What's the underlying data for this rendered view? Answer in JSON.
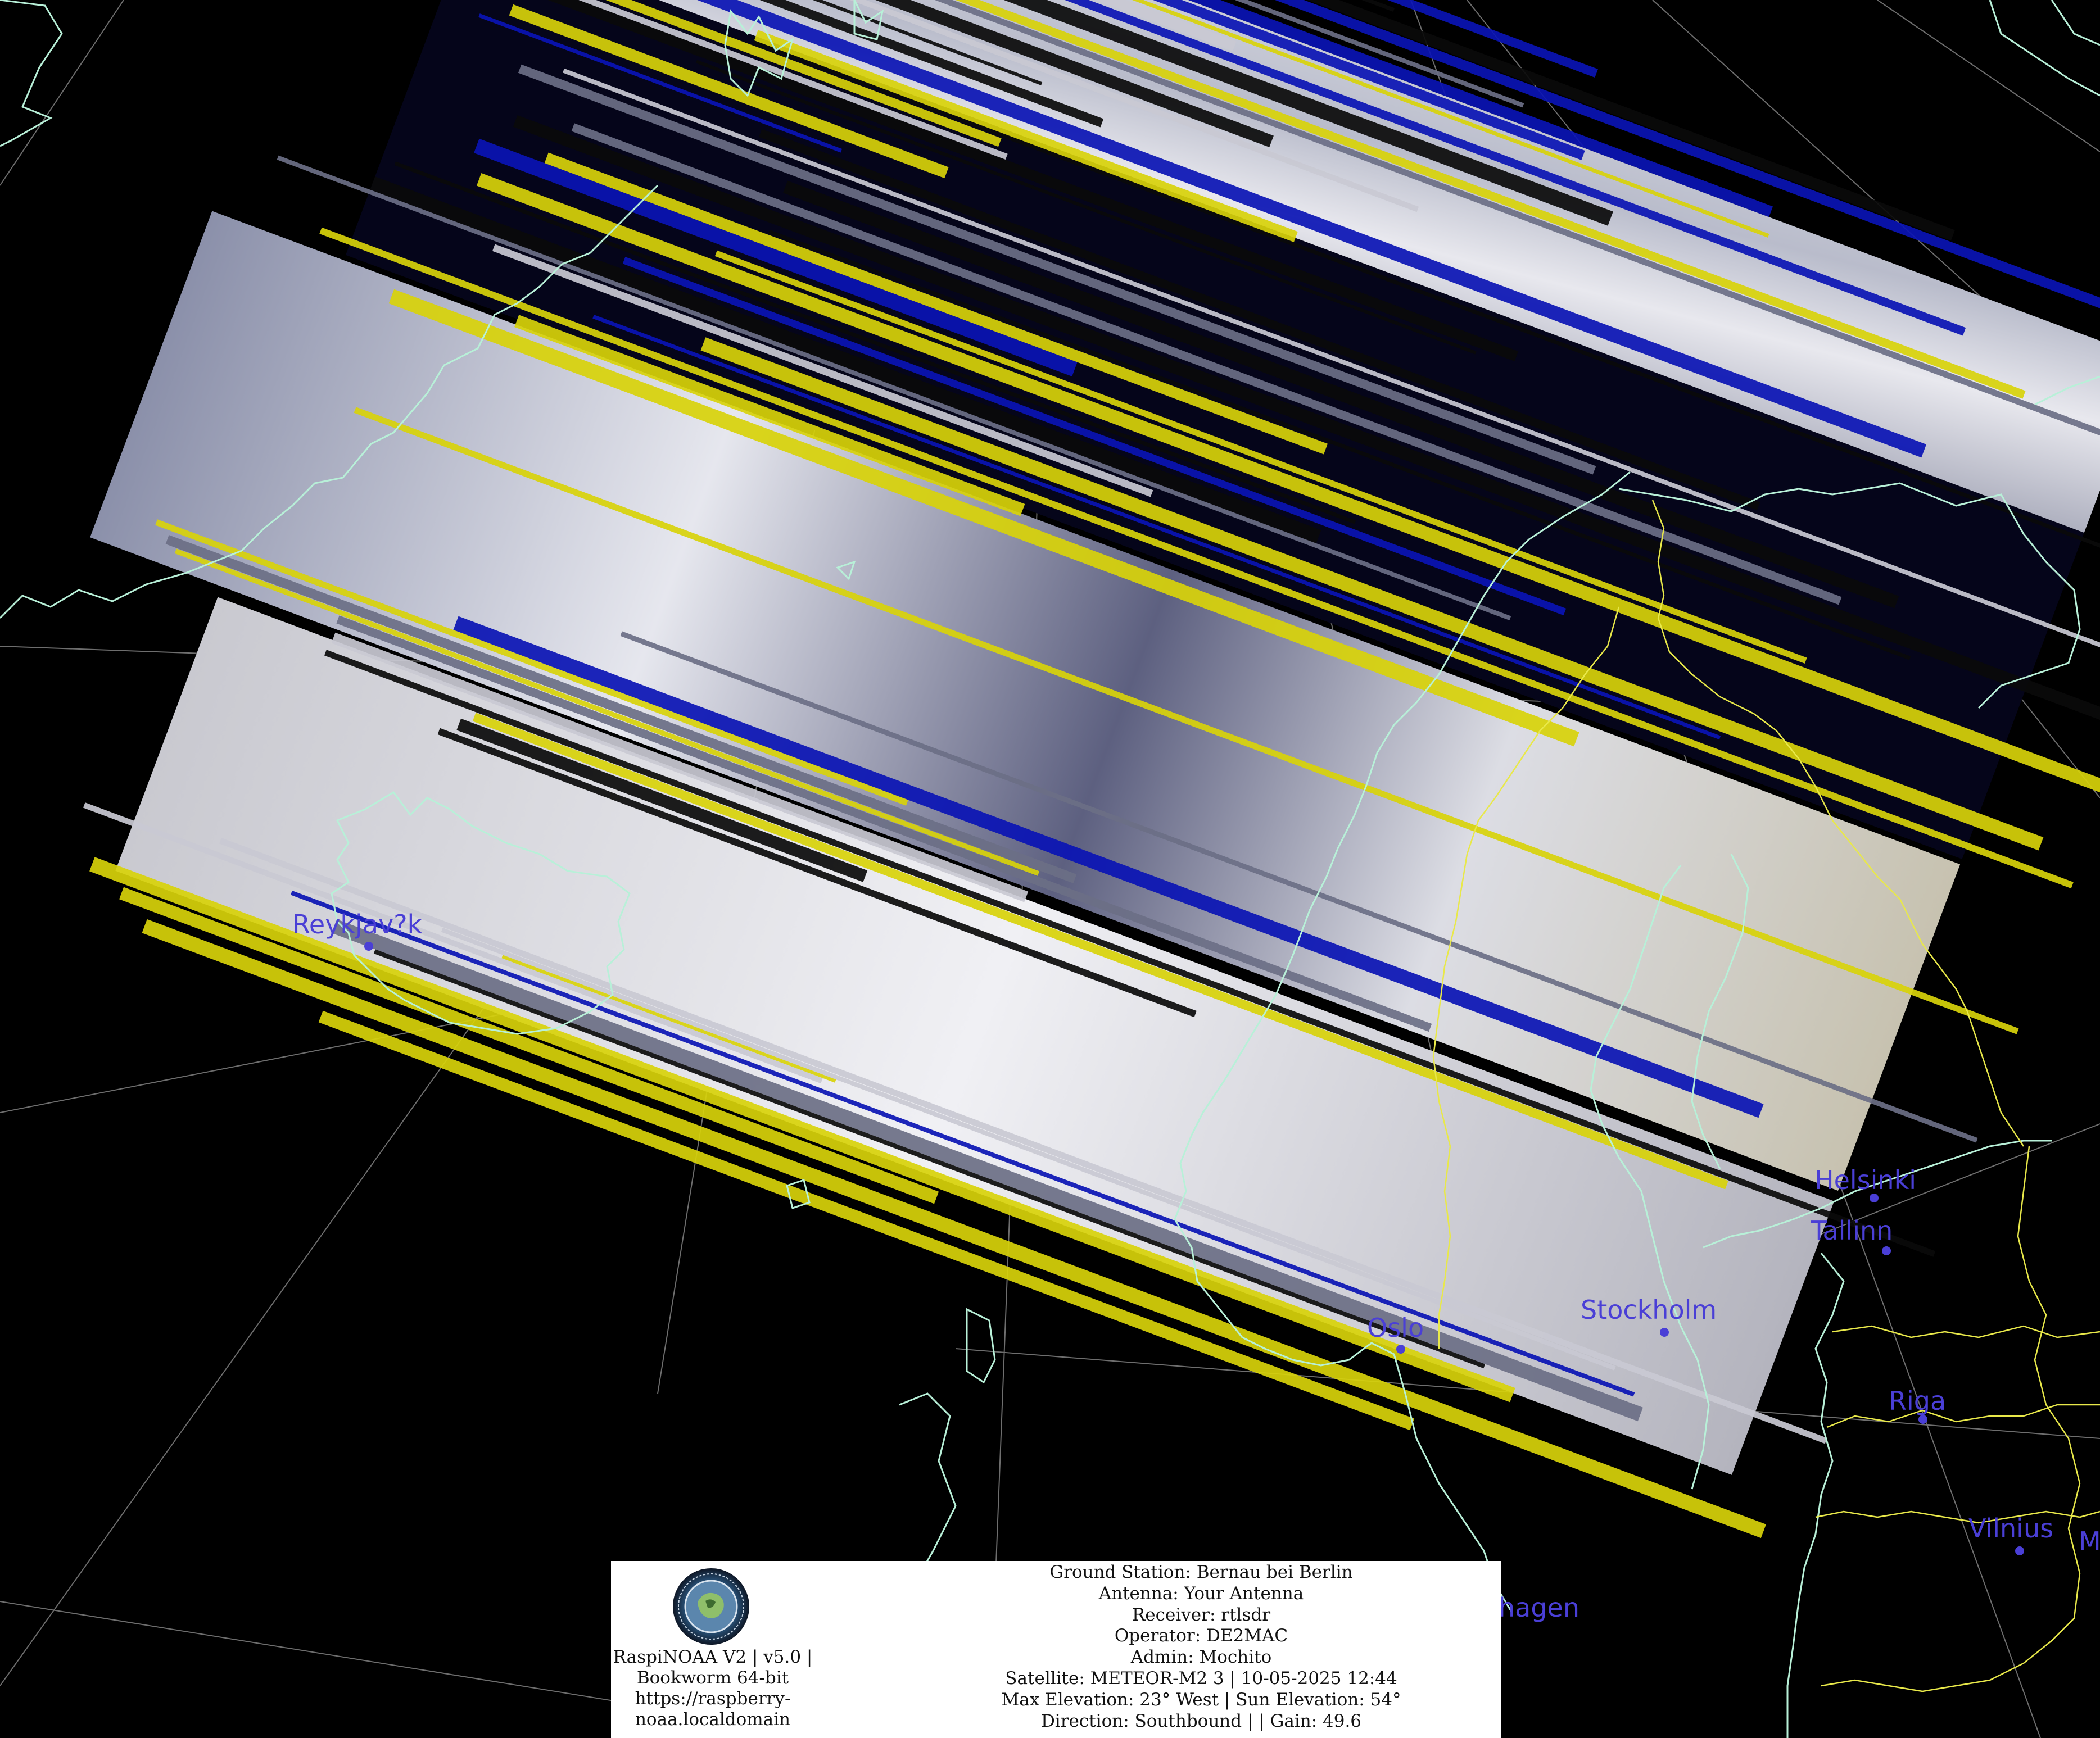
{
  "map": {
    "cities": [
      {
        "id": "reykjavik",
        "name": "Reykjav?k"
      },
      {
        "id": "helsinki",
        "name": "Helsinki"
      },
      {
        "id": "tallinn",
        "name": "Tallinn"
      },
      {
        "id": "stockholm",
        "name": "Stockholm"
      },
      {
        "id": "oslo",
        "name": "Oslo"
      },
      {
        "id": "riga",
        "name": "Riga"
      },
      {
        "id": "vilnius",
        "name": "Vilnius"
      },
      {
        "id": "copenhagen",
        "name": "hagen"
      },
      {
        "id": "minsk",
        "name": "M"
      }
    ],
    "colors": {
      "background": "#000000",
      "coastline": "#b8f0d8",
      "borders": "#e8e84a",
      "graticule": "#c8c8c8",
      "city_label": "#4a3fd6",
      "noise_blue": "#0a14b4",
      "noise_yellow": "#d8d20a"
    }
  },
  "info": {
    "software": [
      "RaspiNOAA V2 | v5.0 |",
      "Bookworm 64-bit",
      "https://raspberry-",
      "noaa.localdomain"
    ],
    "station": [
      "Ground Station: Bernau bei Berlin",
      "Antenna: Your Antenna",
      "Receiver: rtlsdr",
      "Operator: DE2MAC",
      "Admin: Mochito",
      "Satellite: METEOR-M2 3 | 10-05-2025 12:44",
      "Max Elevation: 23° West | Sun Elevation: 54°",
      "Direction: Southbound | | Gain: 49.6"
    ]
  }
}
